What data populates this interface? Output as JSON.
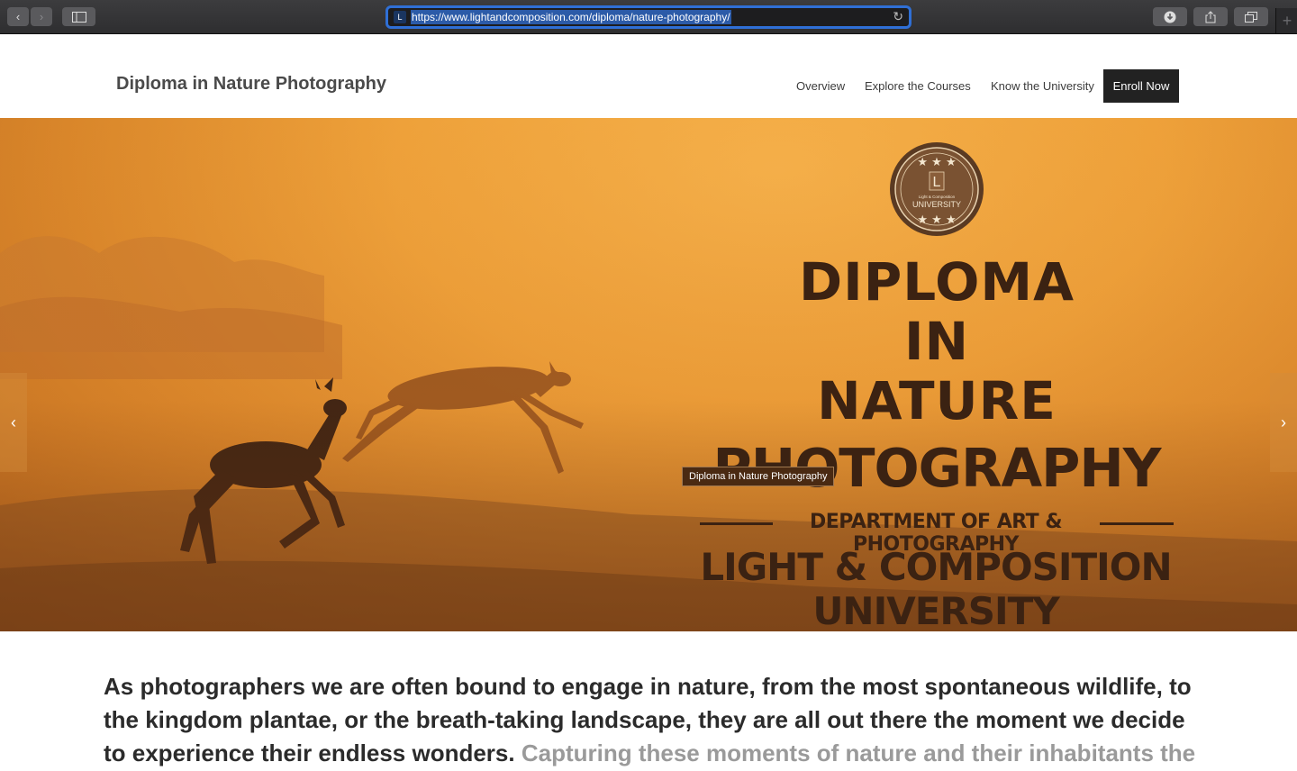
{
  "browser": {
    "url": "https://www.lightandcomposition.com/diploma/nature-photography/",
    "favicon_letter": "L",
    "back_glyph": "‹",
    "forward_glyph": "›",
    "reload_glyph": "↻",
    "new_tab_glyph": "+"
  },
  "header": {
    "site_title": "Diploma in Nature Photography",
    "nav": [
      "Overview",
      "Explore the Courses",
      "Know the University"
    ],
    "enroll_label": "Enroll Now"
  },
  "hero": {
    "badge_letter": "L",
    "badge_small": "Light & Composition",
    "badge_name": "UNIVERSITY",
    "title_lines": [
      "DIPLOMA",
      "IN",
      "NATURE",
      "PHOTOGRAPHY"
    ],
    "department": "DEPARTMENT OF ART & PHOTOGRAPHY",
    "university": "LIGHT & COMPOSITION UNIVERSITY",
    "tooltip": "Diploma in Nature Photography",
    "prev_glyph": "‹",
    "next_glyph": "›"
  },
  "intro": {
    "bold_text": "As photographers we are often bound to engage in nature, from the most spontaneous wildlife, to the kingdom plantae, or the breath-taking landscape, they are all out there the moment we decide to experience their endless wonders.",
    "muted_text": "Capturing these moments of nature and their inhabitants the"
  },
  "colors": {
    "accent": "#2f6fd6",
    "hero_text": "#3b2212",
    "enroll_bg": "#222222"
  }
}
